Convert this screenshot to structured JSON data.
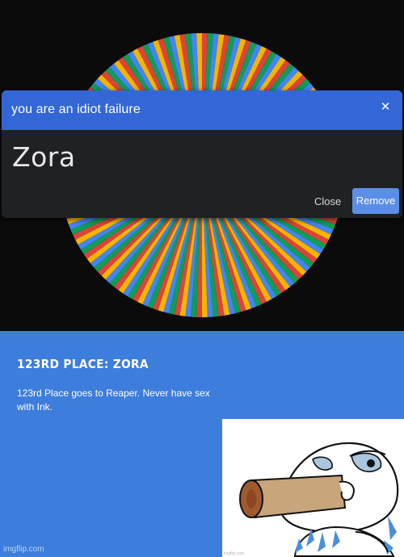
{
  "wheel": {
    "colors": [
      "#db4437",
      "#0f9d58",
      "#4285f4",
      "#f4b400"
    ],
    "segment_count": 160
  },
  "dialog": {
    "title": "you are an idiot failure",
    "close_icon": "close-icon",
    "winner": "Zora",
    "close_label": "Close",
    "remove_label": "Remove"
  },
  "result": {
    "heading": "123RD PLACE: ZORA",
    "description": "123rd Place goes to Reaper. Never have sex with Ink."
  },
  "drawing": {
    "watermark": "imgflip.com"
  },
  "watermark": "imgflip.com"
}
